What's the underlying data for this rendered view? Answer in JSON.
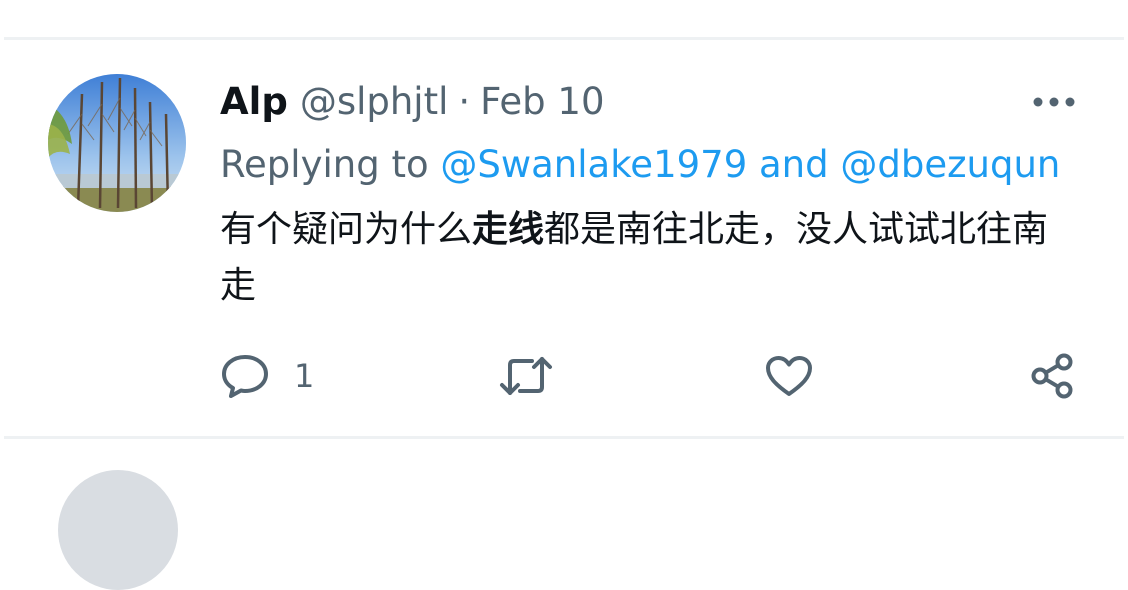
{
  "tweet": {
    "author_name": "Alp",
    "handle": "@slphjtl",
    "separator": "·",
    "date": "Feb 10",
    "replying_prefix": "Replying to",
    "mention_1": "@Swanlake1979",
    "replying_joiner": "and",
    "mention_2": "@dbezuqun",
    "text_part_1": "有个疑问为什么",
    "text_bold": "走线",
    "text_part_2": "都是南往北走，没人试试北往南走"
  },
  "actions": {
    "reply_count": "1",
    "reply_icon": "reply-icon",
    "retweet_icon": "retweet-icon",
    "like_icon": "heart-icon",
    "share_icon": "share-icon",
    "more_icon": "more-icon"
  },
  "colors": {
    "text": "#0f1419",
    "secondary": "#536471",
    "link": "#1d9bf0",
    "divider": "#eef1f3"
  }
}
